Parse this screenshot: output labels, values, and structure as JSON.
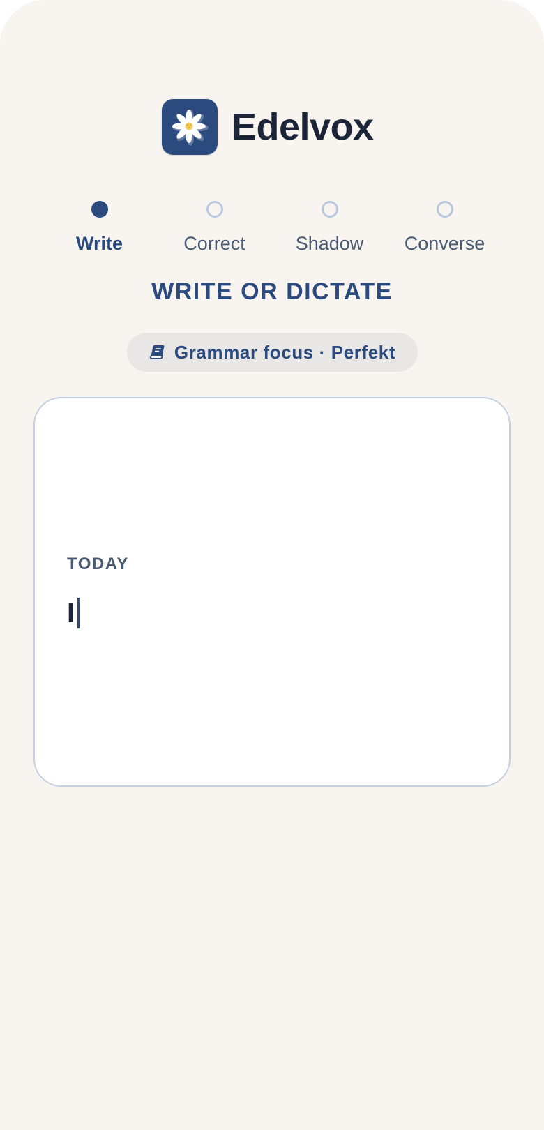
{
  "app": {
    "name": "Edelvox",
    "logo_icon": "edelweiss-flower-icon"
  },
  "steps": [
    {
      "label": "Write",
      "active": true
    },
    {
      "label": "Correct",
      "active": false
    },
    {
      "label": "Shadow",
      "active": false
    },
    {
      "label": "Converse",
      "active": false
    }
  ],
  "section_title": "WRITE OR DICTATE",
  "focus_pill": {
    "icon": "book-icon",
    "text": "Grammar focus · Perfekt"
  },
  "editor": {
    "date_label": "TODAY",
    "text": "I"
  },
  "colors": {
    "accent": "#2b4a7d",
    "background": "#f8f5f1",
    "text_dark": "#1c2438",
    "text_muted": "#4a5a70",
    "inactive_dot": "#b9c8dc",
    "editor_border": "#c6d0e0",
    "pill_background": "#e8e7e6"
  }
}
